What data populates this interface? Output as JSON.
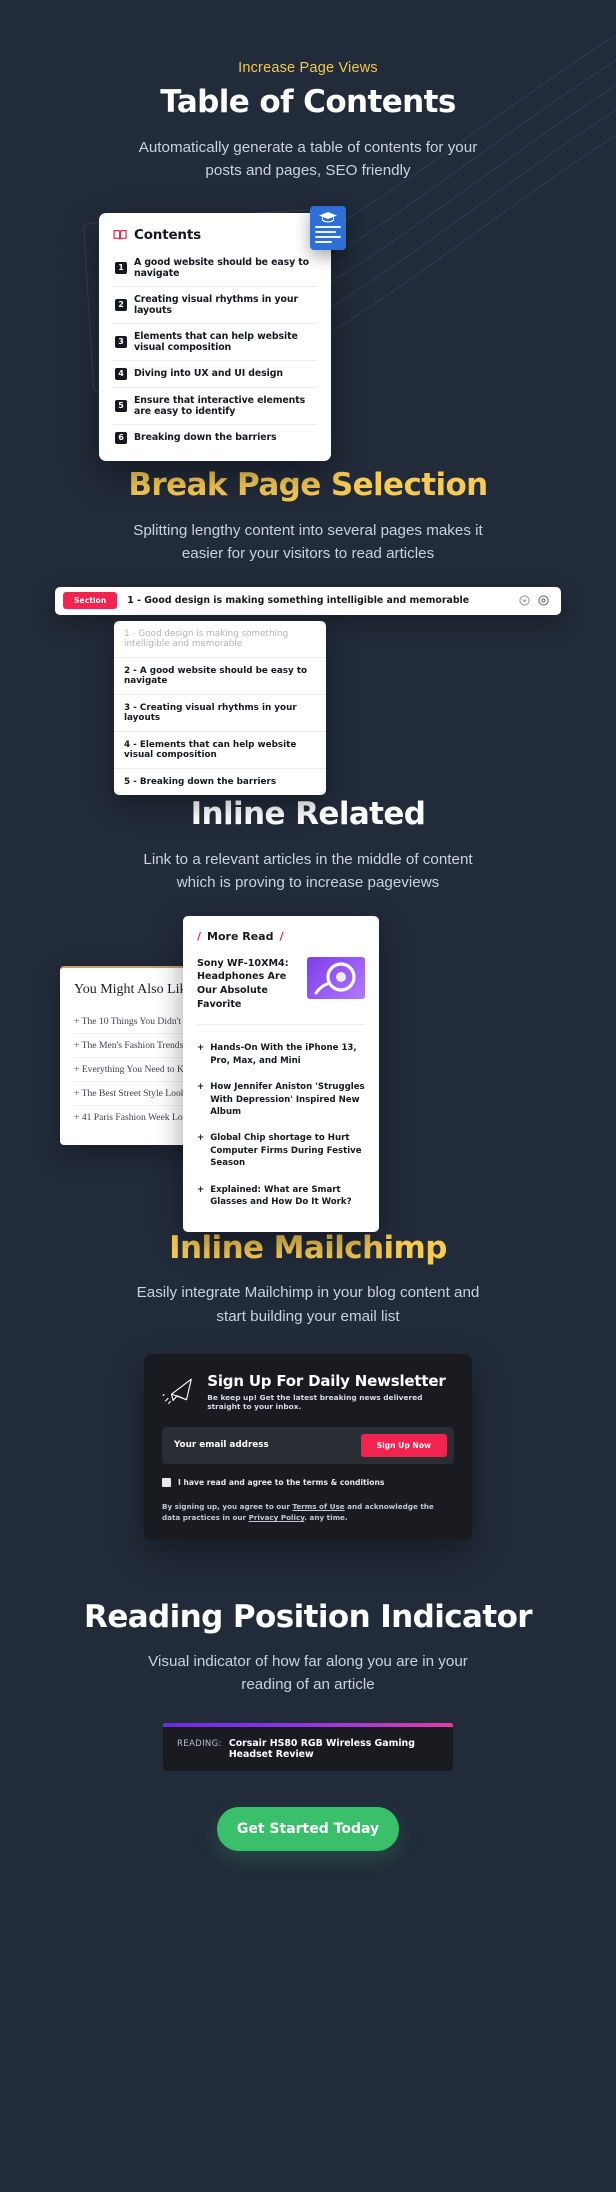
{
  "theme": {
    "background": "#222b3a",
    "accent_yellow": "#f7ca52",
    "accent_pink": "#f2234f",
    "cta_green": "#3ac06a",
    "card_dark": "#191b20"
  },
  "sections": {
    "toc": {
      "eyebrow": "Increase Page Views",
      "title": "Table of Contents",
      "subtitle": "Automatically generate a table of contents for your posts and pages, SEO friendly",
      "card_title": "Contents",
      "items": [
        {
          "num": "1",
          "label": "A good website should be easy to navigate"
        },
        {
          "num": "2",
          "label": "Creating visual rhythms in your layouts"
        },
        {
          "num": "3",
          "label": "Elements that can help website visual composition"
        },
        {
          "num": "4",
          "label": "Diving into UX and UI design"
        },
        {
          "num": "5",
          "label": "Ensure that interactive elements are easy to identify"
        },
        {
          "num": "6",
          "label": "Breaking down the barriers"
        }
      ]
    },
    "break_page": {
      "title": "Break Page Selection",
      "subtitle": "Splitting lengthy content into several pages makes it easier for your visitors to read articles",
      "badge": "Section",
      "current": "1 - Good design is making something intelligible and memorable",
      "options": [
        "1 - Good design is making something intelligible and memorable",
        "2 - A good website should be easy to navigate",
        "3 - Creating visual rhythms in your layouts",
        "4 - Elements that can help website visual composition",
        "5 - Breaking down the barriers"
      ]
    },
    "inline_related": {
      "title": "Inline Related",
      "subtitle": "Link to a relevant articles in the middle of content which is proving to increase pageviews",
      "left_card": {
        "title": "You Might Also Like",
        "items": [
          "The 10 Things You Didn't Know",
          "The Men's Fashion Trends You",
          "Everything You Need to Know",
          "The Best Street Style Looks Fro",
          "41 Paris Fashion Week Looks Th"
        ]
      },
      "right_card": {
        "label": "More Read",
        "slash": "/",
        "featured_title": "Sony WF-10XM4: Headphones Are Our Absolute Favorite",
        "items": [
          "Hands-On With the iPhone 13, Pro, Max, and Mini",
          "How Jennifer Aniston 'Struggles With Depression' Inspired New Album",
          "Global Chip shortage to Hurt Computer Firms During Festive Season",
          "Explained: What are Smart Glasses and How Do It Work?"
        ],
        "plus": "+"
      }
    },
    "mailchimp": {
      "title": "Inline Mailchimp",
      "subtitle": "Easily integrate Mailchimp in your blog content and start building your email list",
      "form_title": "Sign Up For Daily Newsletter",
      "form_subtitle": "Be keep up! Get the latest breaking news delivered straight to your inbox.",
      "email_placeholder": "Your email address",
      "button": "Sign Up Now",
      "checkbox_label": "I have read and agree to the terms & conditions",
      "fine_print_1": "By signing up, you agree to our ",
      "fine_print_link_1": "Terms of Use",
      "fine_print_2": " and acknowledge the data practices in our ",
      "fine_print_link_2": "Privacy Policy",
      "fine_print_3": ". any time."
    },
    "reading": {
      "title": "Reading Position Indicator",
      "subtitle": "Visual indicator of how far along you are in your reading of an article",
      "label": "READING:",
      "article": "Corsair HS80 RGB Wireless Gaming Headset Review"
    },
    "cta": {
      "label": "Get Started Today"
    }
  }
}
